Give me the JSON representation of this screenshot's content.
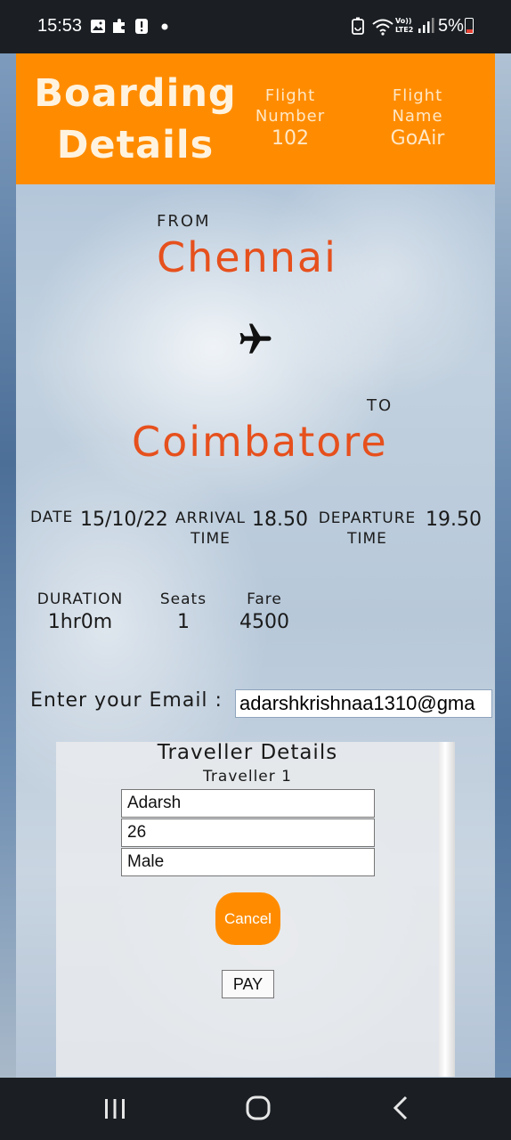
{
  "status_bar": {
    "time": "15:53",
    "battery": "5%",
    "icons": [
      "gallery-icon",
      "puzzle-icon",
      "alert-icon",
      "dot-icon",
      "battery-saver-icon",
      "wifi-icon",
      "volte-icon",
      "signal-icon"
    ],
    "volte_text": "Vo)) LTE2"
  },
  "header": {
    "title_line1": "Boarding",
    "title_line2": "Details",
    "flight_number_label_1": "Flight",
    "flight_number_label_2": "Number",
    "flight_number": "102",
    "flight_name_label_1": "Flight",
    "flight_name_label_2": "Name",
    "flight_name": "GoAir"
  },
  "route": {
    "from_label": "FROM",
    "from_city": "Chennai",
    "plane_icon": "airplane-icon",
    "to_label": "TO",
    "to_city": "Coimbatore"
  },
  "schedule": {
    "date_label": "DATE",
    "date": "15/10/22",
    "arrival_label_1": "ARRIVAL",
    "arrival_label_2": "TIME",
    "arrival": "18.50",
    "departure_label_1": "DEPARTURE",
    "departure_label_2": "TIME",
    "departure": "19.50"
  },
  "booking": {
    "duration_label": "DURATION",
    "duration": "1hr0m",
    "seats_label": "Seats",
    "seats": "1",
    "fare_label": "Fare",
    "fare": "4500"
  },
  "email": {
    "label": "Enter your Email :",
    "value": "adarshkrishnaa1310@gma"
  },
  "traveller": {
    "title": "Traveller Details",
    "subtitle": "Traveller 1",
    "name": "Adarsh",
    "age": "26",
    "gender": "Male",
    "cancel_label": "Cancel",
    "pay_label": "PAY"
  },
  "colors": {
    "accent": "#ff8c00",
    "city": "#e6501d",
    "bars": "#1b1f24"
  }
}
